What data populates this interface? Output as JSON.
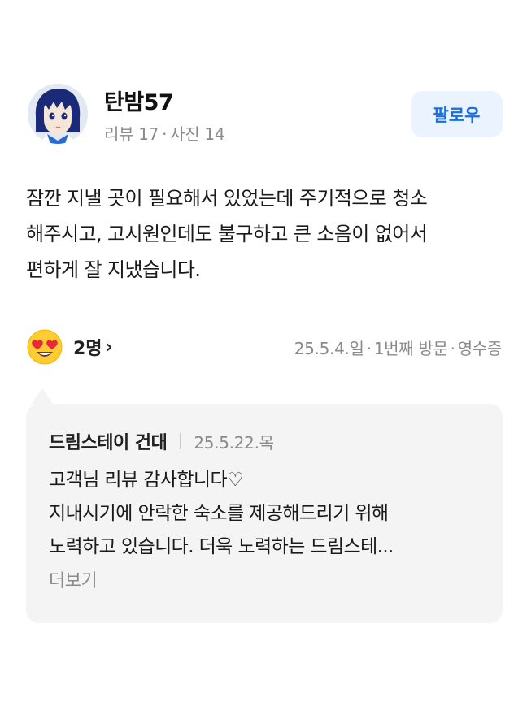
{
  "reviewer": {
    "name": "탄밤57",
    "reviews_label": "리뷰 17",
    "dot": "·",
    "photos_label": "사진 14",
    "avatar_icon": "anime-character-avatar"
  },
  "follow_button": {
    "label": "팔로우",
    "color": "#1a6fe0",
    "bg": "#eaf3fe"
  },
  "review": {
    "lines": [
      "잠깐 지낼 곳이 필요해서 있었는데 주기적으로 청소",
      "해주시고, 고시원인데도 불구하고 큰 소음이 없어서",
      "편하게 잘 지냈습니다."
    ]
  },
  "reaction": {
    "emoji": "heart-eyes-emoji",
    "count": "2명",
    "chevron": "›"
  },
  "visit_meta": {
    "date": "25.5.4.일",
    "visit": "1번째 방문",
    "proof": "영수증",
    "dot": "·"
  },
  "owner_reply": {
    "store": "드림스테이 건대",
    "date": "25.5.22.목",
    "lines": [
      "고객님 리뷰 감사합니다♡",
      "지내시기에 안락한 숙소를 제공해드리기 위해",
      "노력하고 있습니다. 더욱 노력하는 드림스테..."
    ],
    "more": "더보기"
  }
}
